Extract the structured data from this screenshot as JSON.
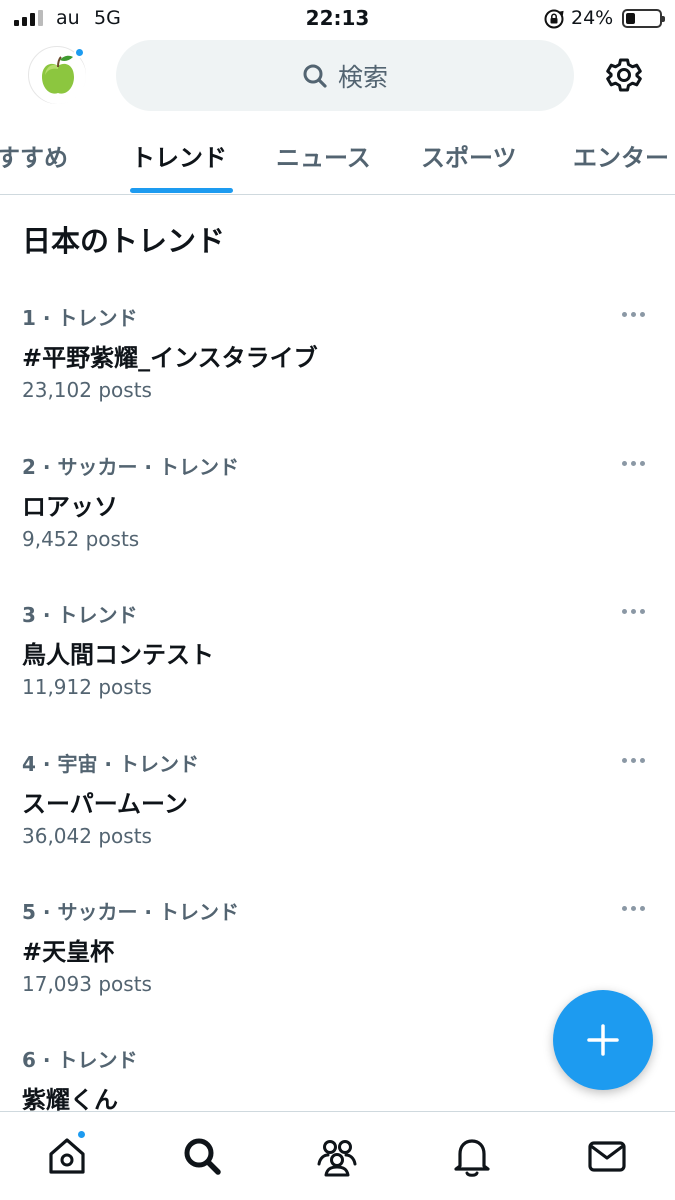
{
  "status_bar": {
    "carrier": "au",
    "network": "5G",
    "time": "22:13",
    "battery_percent_label": "24%",
    "battery_level": 0.24
  },
  "header": {
    "search_label": "検索",
    "avatar_icon": "apple-avatar",
    "settings_icon": "gear-icon"
  },
  "tabs": [
    {
      "label": "すすめ",
      "active": false
    },
    {
      "label": "トレンド",
      "active": true
    },
    {
      "label": "ニュース",
      "active": false
    },
    {
      "label": "スポーツ",
      "active": false
    },
    {
      "label": "エンター",
      "active": false
    }
  ],
  "section_title": "日本のトレンド",
  "trends": [
    {
      "meta": "1 · トレンド",
      "name": "#平野紫耀_インスタライブ",
      "count": "23,102 posts"
    },
    {
      "meta": "2 · サッカー · トレンド",
      "name": "ロアッソ",
      "count": "9,452 posts"
    },
    {
      "meta": "3 · トレンド",
      "name": "鳥人間コンテスト",
      "count": "11,912 posts"
    },
    {
      "meta": "4 · 宇宙 · トレンド",
      "name": "スーパームーン",
      "count": "36,042 posts"
    },
    {
      "meta": "5 · サッカー · トレンド",
      "name": "#天皇杯",
      "count": "17,093 posts"
    },
    {
      "meta": "6 · トレンド",
      "name": "紫耀くん",
      "count": ""
    }
  ],
  "fab_icon": "plus-icon",
  "bottom_nav": [
    "home-icon",
    "search-icon",
    "communities-icon",
    "notifications-icon",
    "messages-icon"
  ],
  "colors": {
    "accent": "#1d9bf0",
    "text_primary": "#0f1419",
    "text_secondary": "#536471",
    "search_bg": "#eff3f4"
  }
}
